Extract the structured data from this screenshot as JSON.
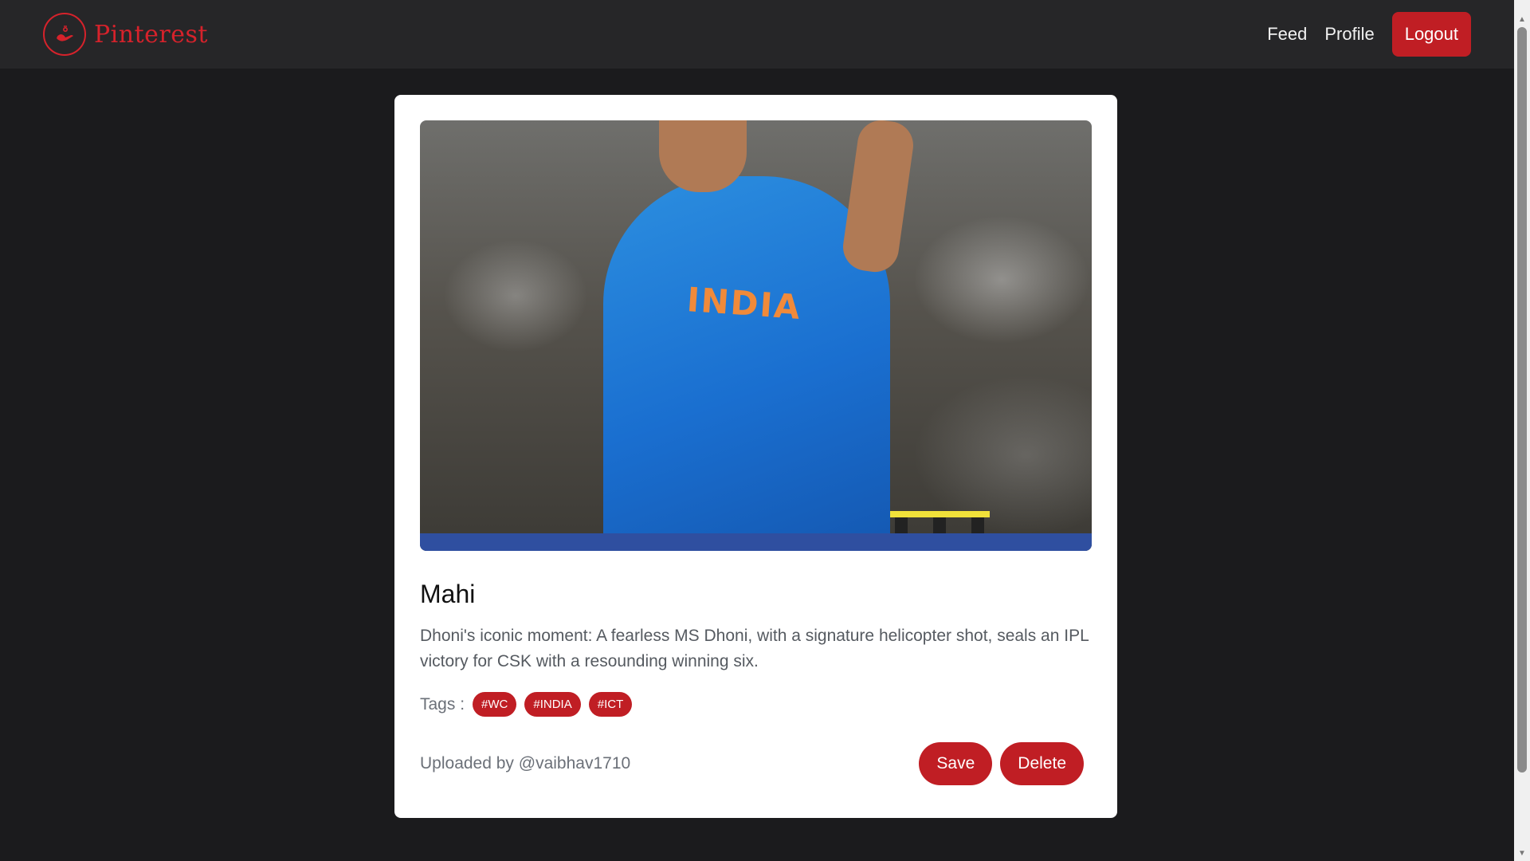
{
  "navbar": {
    "brand_name": "Pinterest",
    "links": {
      "feed": "Feed",
      "profile": "Profile"
    },
    "logout_label": "Logout",
    "accent_color": "#c01e24"
  },
  "pin": {
    "image_text": "INDIA",
    "title": "Mahi",
    "description": "Dhoni's iconic moment: A fearless MS Dhoni, with a signature helicopter shot, seals an IPL victory for CSK with a resounding winning six.",
    "tags_label": "Tags :",
    "tags": [
      "#WC",
      "#INDIA",
      "#ICT"
    ],
    "uploaded_by": "Uploaded by @vaibhav1710",
    "save_label": "Save",
    "delete_label": "Delete"
  }
}
